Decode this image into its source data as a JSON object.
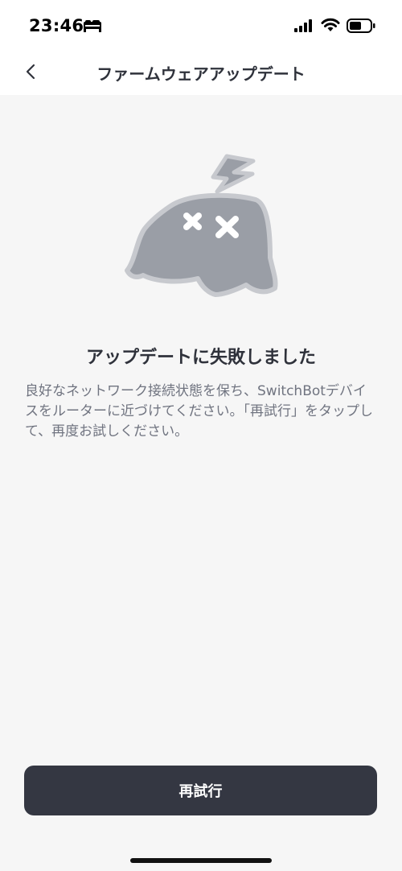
{
  "status_bar": {
    "time": "23:46",
    "icons": [
      "bed-icon",
      "signal-icon",
      "wifi-icon",
      "battery-icon"
    ]
  },
  "nav": {
    "title": "ファームウェアアップデート",
    "back_icon": "chevron-left-icon"
  },
  "content": {
    "illustration": "sad-robot-icon",
    "title": "アップデートに失敗しました",
    "message": "良好なネットワーク接続状態を保ち、SwitchBotデバイスをルーターに近づけてください。「再試行」をタップして、再度お試しください。"
  },
  "footer": {
    "retry_label": "再試行"
  },
  "colors": {
    "background": "#f6f6f6",
    "button": "#343742",
    "title_text": "#2f323b",
    "body_text": "#707480",
    "illustration_fill": "#9a9ea6",
    "illustration_outline": "#c7c9ce"
  }
}
